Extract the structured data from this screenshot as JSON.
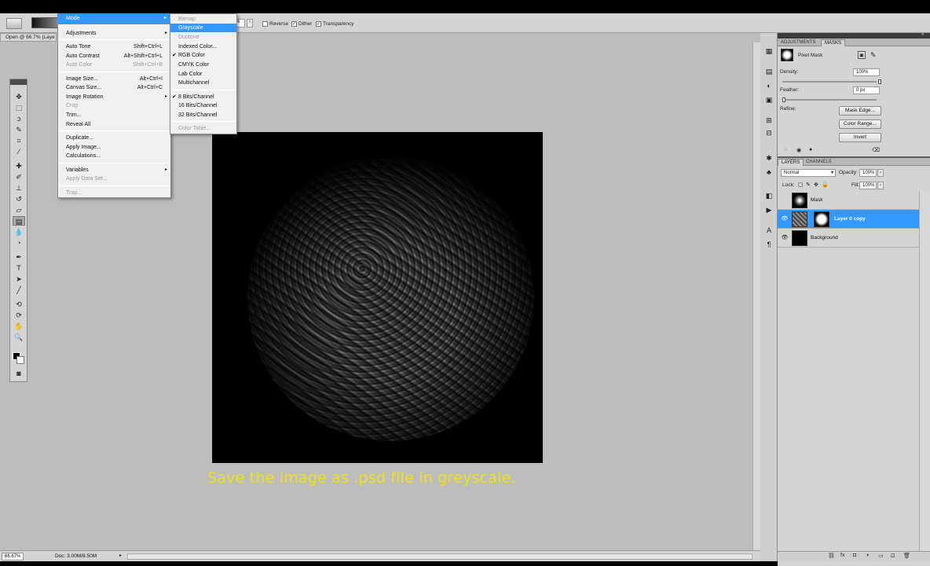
{
  "options_bar": {
    "percent_value": "%",
    "checkboxes": [
      {
        "label": "Reverse",
        "checked": false
      },
      {
        "label": "Dither",
        "checked": true
      },
      {
        "label": "Transparency",
        "checked": true
      }
    ]
  },
  "document_tab": "Open @ 66.7% (Laye",
  "mode_menu_label": "Mode",
  "image_menu": {
    "items": [
      {
        "label": "Adjustments",
        "shortcut": "",
        "submenu": true,
        "disabled": false
      },
      {
        "label": "Auto Tone",
        "shortcut": "Shift+Ctrl+L",
        "disabled": false
      },
      {
        "label": "Auto Contrast",
        "shortcut": "Alt+Shift+Ctrl+L",
        "disabled": false
      },
      {
        "label": "Auto Color",
        "shortcut": "Shift+Ctrl+B",
        "disabled": true
      },
      {
        "label": "Image Size...",
        "shortcut": "Alt+Ctrl+I",
        "disabled": false
      },
      {
        "label": "Canvas Size...",
        "shortcut": "Alt+Ctrl+C",
        "disabled": false
      },
      {
        "label": "Image Rotation",
        "shortcut": "",
        "submenu": true,
        "disabled": false
      },
      {
        "label": "Crop",
        "shortcut": "",
        "disabled": true
      },
      {
        "label": "Trim...",
        "shortcut": "",
        "disabled": false
      },
      {
        "label": "Reveal All",
        "shortcut": "",
        "disabled": false
      },
      {
        "label": "Duplicate...",
        "shortcut": "",
        "disabled": false
      },
      {
        "label": "Apply Image...",
        "shortcut": "",
        "disabled": false
      },
      {
        "label": "Calculations...",
        "shortcut": "",
        "disabled": false
      },
      {
        "label": "Variables",
        "shortcut": "",
        "submenu": true,
        "disabled": false
      },
      {
        "label": "Apply Data Set...",
        "shortcut": "",
        "disabled": true
      },
      {
        "label": "Trap...",
        "shortcut": "",
        "disabled": true
      }
    ]
  },
  "mode_submenu": {
    "items": [
      {
        "label": "Bitmap",
        "disabled": true,
        "checked": false,
        "highlighted": false
      },
      {
        "label": "Grayscale",
        "disabled": false,
        "checked": false,
        "highlighted": true
      },
      {
        "label": "Duotone",
        "disabled": true,
        "checked": false,
        "highlighted": false
      },
      {
        "label": "Indexed Color...",
        "disabled": false,
        "checked": false,
        "highlighted": false
      },
      {
        "label": "RGB Color",
        "disabled": false,
        "checked": true,
        "highlighted": false
      },
      {
        "label": "CMYK Color",
        "disabled": false,
        "checked": false,
        "highlighted": false
      },
      {
        "label": "Lab Color",
        "disabled": false,
        "checked": false,
        "highlighted": false
      },
      {
        "label": "Multichannel",
        "disabled": false,
        "checked": false,
        "highlighted": false
      },
      {
        "label": "8 Bits/Channel",
        "disabled": false,
        "checked": true,
        "highlighted": false
      },
      {
        "label": "16 Bits/Channel",
        "disabled": false,
        "checked": false,
        "highlighted": false
      },
      {
        "label": "32 Bits/Channel",
        "disabled": false,
        "checked": false,
        "highlighted": false
      },
      {
        "label": "Color Table...",
        "disabled": true,
        "checked": false,
        "highlighted": false
      }
    ]
  },
  "caption": "Save the image as .psd file in greyscale.",
  "status_bar": {
    "zoom": "66.67%",
    "doc_info": "Doc: 3.00M/8.50M"
  },
  "adjustments_panel": {
    "tabs": [
      "ADJUSTMENTS",
      "MASKS"
    ],
    "active_tab": "MASKS",
    "mask_type": "Pixel Mask",
    "density_label": "Density:",
    "density_value": "100%",
    "feather_label": "Feather:",
    "feather_value": "0 px",
    "refine_label": "Refine:",
    "buttons": [
      "Mask Edge...",
      "Color Range...",
      "Invert"
    ]
  },
  "layers_panel": {
    "tabs": [
      "LAYERS",
      "CHANNELS"
    ],
    "active_tab": "LAYERS",
    "blend_mode": "Normal",
    "opacity_label": "Opacity:",
    "opacity_value": "100%",
    "lock_label": "Lock:",
    "fill_label": "Fill:",
    "fill_value": "100%",
    "layers": [
      {
        "name": "Mask",
        "visible": false,
        "selected": false
      },
      {
        "name": "Layer 0 copy",
        "visible": true,
        "selected": true
      },
      {
        "name": "Background",
        "visible": true,
        "selected": false
      }
    ]
  },
  "colors": {
    "highlight": "#3399ff",
    "caption": "#e8e219"
  }
}
